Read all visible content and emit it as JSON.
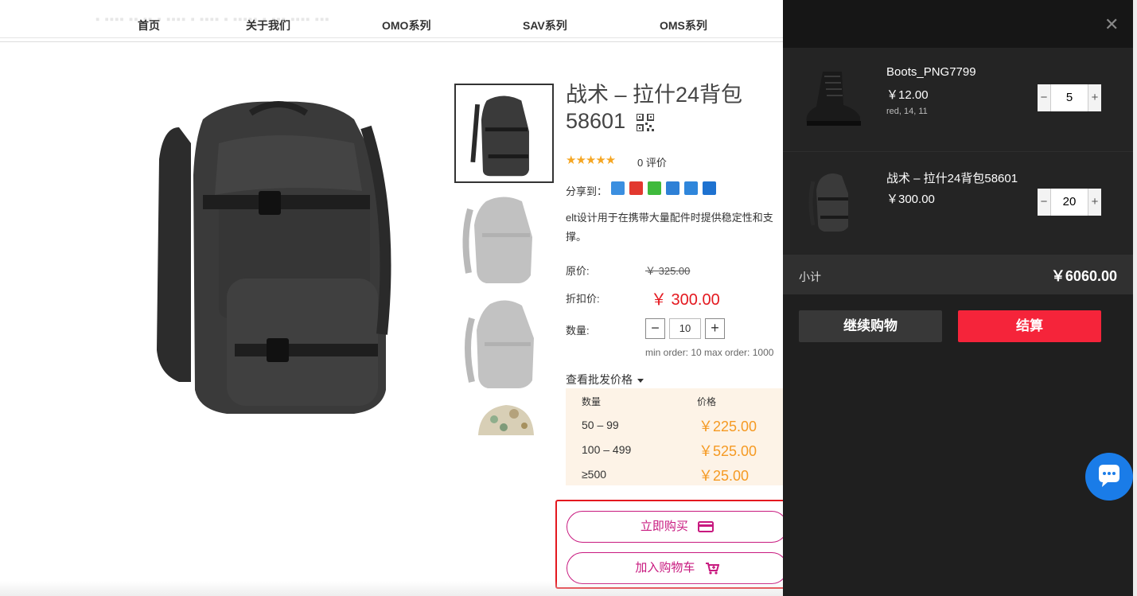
{
  "nav": {
    "items": [
      "首页",
      "关于我们",
      "OMO系列",
      "SAV系列",
      "OMS系列"
    ]
  },
  "product": {
    "title": "战术 – 拉什24背包58601",
    "rating_stars": "★★★★★",
    "reviews": "0 评价",
    "share_label": "分享到：",
    "description": "elt设计用于在携带大量配件时提供稳定性和支撑。",
    "original_price_label": "原价:",
    "original_price": "￥ 325.00",
    "discount_price_label": "折扣价:",
    "discount_price": "￥ 300.00",
    "quantity_label": "数量:",
    "quantity": "10",
    "min_max": "min order: 10 max order: 1000",
    "wholesale_toggle": "查看批发价格",
    "wholesale": {
      "header_qty": "数量",
      "header_price": "价格",
      "rows": [
        {
          "qty": "50 – 99",
          "price": "￥225.00"
        },
        {
          "qty": "100 – 499",
          "price": "￥525.00"
        },
        {
          "qty": "≥500",
          "price": "￥25.00"
        }
      ]
    },
    "buy_now": "立即购买",
    "add_to_cart": "加入购物车"
  },
  "cart": {
    "items": [
      {
        "name": "Boots_PNG7799",
        "price": "￥12.00",
        "attrs": "red, 14, 11",
        "qty": "5"
      },
      {
        "name": "战术 – 拉什24背包58601",
        "price": "￥300.00",
        "qty": "20"
      }
    ],
    "subtotal_label": "小计",
    "subtotal": "￥6060.00",
    "continue_label": "继续购物",
    "checkout_label": "结算"
  },
  "colors": {
    "accent_red": "#e4181f",
    "brand_magenta": "#c8197f",
    "checkout_red": "#f5243a",
    "wholesale_orange": "#f59a23",
    "drawer_bg": "#1f1f1f",
    "chat_blue": "#1a7ce8"
  }
}
